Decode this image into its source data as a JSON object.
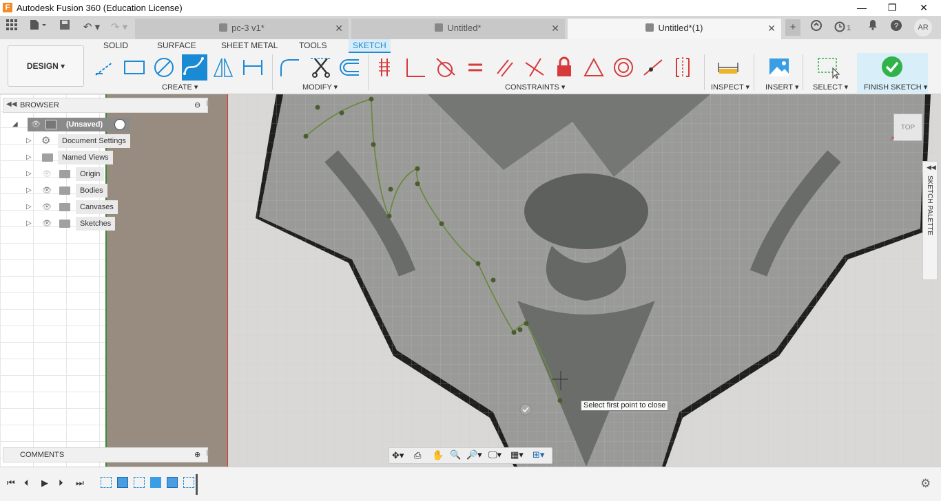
{
  "app": {
    "title": "Autodesk Fusion 360 (Education License)",
    "logo_letter": "F"
  },
  "window_controls": {
    "minimize": "—",
    "maximize": "❐",
    "close": "✕"
  },
  "tabs": [
    {
      "label": "pc-3 v1*",
      "active": false
    },
    {
      "label": "Untitled*",
      "active": false
    },
    {
      "label": "Untitled*(1)",
      "active": true
    }
  ],
  "tabbar_right": {
    "job_count": "1",
    "user_initials": "AR"
  },
  "workspace": {
    "label": "DESIGN"
  },
  "toolbar_tabs": [
    "SOLID",
    "SURFACE",
    "SHEET METAL",
    "TOOLS",
    "SKETCH"
  ],
  "toolbar_active_tab": "SKETCH",
  "groups": {
    "create": "CREATE",
    "modify": "MODIFY",
    "constraints": "CONSTRAINTS",
    "inspect": "INSPECT",
    "insert": "INSERT",
    "select": "SELECT",
    "finish": "FINISH SKETCH"
  },
  "browser": {
    "title": "BROWSER",
    "root": "(Unsaved)",
    "items": [
      {
        "label": "Document Settings"
      },
      {
        "label": "Named Views"
      },
      {
        "label": "Origin"
      },
      {
        "label": "Bodies"
      },
      {
        "label": "Canvases"
      },
      {
        "label": "Sketches"
      }
    ]
  },
  "comments": {
    "title": "COMMENTS"
  },
  "palette": {
    "label": "SKETCH PALETTE"
  },
  "viewcube": {
    "label": "TOP"
  },
  "tooltip": {
    "text": "Select first point to close"
  },
  "colors": {
    "accent": "#1a8ad4",
    "finish_green": "#2fb34a",
    "sketch_line": "#6a8a40",
    "canvas_tan": "#978c7f"
  }
}
